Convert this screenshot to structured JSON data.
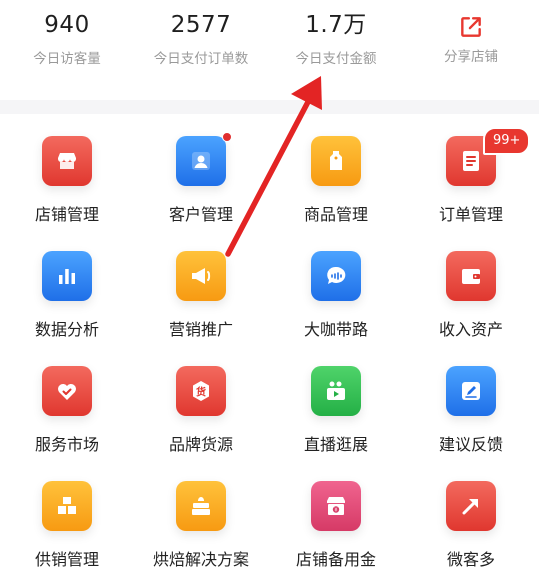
{
  "stats": [
    {
      "value": "940",
      "label": "今日访客量"
    },
    {
      "value": "2577",
      "label": "今日支付订单数"
    },
    {
      "value": "1.7万",
      "label": "今日支付金额"
    }
  ],
  "share": {
    "label": "分享店铺",
    "icon": "share-icon"
  },
  "grid": {
    "items": [
      {
        "label": "店铺管理",
        "icon": "store-icon"
      },
      {
        "label": "客户管理",
        "icon": "user-icon"
      },
      {
        "label": "商品管理",
        "icon": "tag-icon"
      },
      {
        "label": "订单管理",
        "icon": "order-icon",
        "badge": "99+"
      },
      {
        "label": "数据分析",
        "icon": "bar-chart-icon"
      },
      {
        "label": "营销推广",
        "icon": "megaphone-icon"
      },
      {
        "label": "大咖带路",
        "icon": "chat-icon"
      },
      {
        "label": "收入资产",
        "icon": "wallet-icon"
      },
      {
        "label": "服务市场",
        "icon": "heart-icon"
      },
      {
        "label": "品牌货源",
        "icon": "goods-icon"
      },
      {
        "label": "直播逛展",
        "icon": "video-icon"
      },
      {
        "label": "建议反馈",
        "icon": "edit-icon"
      },
      {
        "label": "供销管理",
        "icon": "boxes-icon"
      },
      {
        "label": "烘焙解决方案",
        "icon": "cake-icon"
      },
      {
        "label": "店铺备用金",
        "icon": "reserve-icon"
      },
      {
        "label": "微客多",
        "icon": "arrow-up-right-icon"
      }
    ]
  },
  "colors": {
    "accent_red": "#e8372f",
    "label_gray": "#9a9a9a",
    "red_gradient": [
      "#f36a5e",
      "#e0372f"
    ],
    "blue_gradient": [
      "#4ba3ff",
      "#1f6fe8"
    ],
    "orange_gradient": [
      "#ffc23b",
      "#f79a12"
    ],
    "green_gradient": [
      "#4fd36a",
      "#24b046"
    ],
    "pink_gradient": [
      "#f0648f",
      "#d63a66"
    ]
  }
}
